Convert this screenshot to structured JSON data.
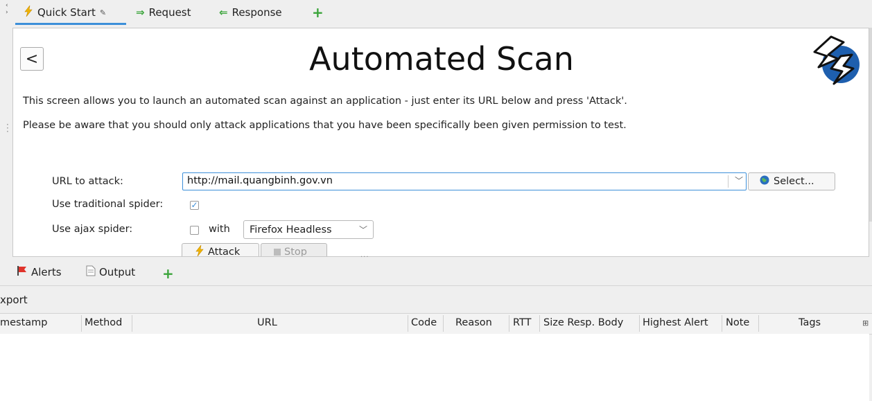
{
  "top_tabs": [
    {
      "label": "Quick Start",
      "icon": "lightning-icon",
      "pinned": true
    },
    {
      "label": "Request",
      "icon": "arrow-right-icon"
    },
    {
      "label": "Response",
      "icon": "arrow-left-icon"
    }
  ],
  "quick_start": {
    "back_label": "<",
    "title": "Automated Scan",
    "description_1": "This screen allows you to launch an automated scan against  an application - just enter its URL below and press 'Attack'.",
    "description_2": "Please be aware that you should only attack applications that you have been specifically been given permission to test.",
    "url_label": "URL to attack:",
    "url_value": "http://mail.quangbinh.gov.vn",
    "select_label": "Select...",
    "traditional_spider_label": "Use traditional spider:",
    "traditional_spider_checked": true,
    "ajax_spider_label": "Use ajax spider:",
    "ajax_spider_checked": false,
    "with_label": "with",
    "browser_value": "Firefox Headless",
    "attack_label": "Attack",
    "stop_label": "Stop"
  },
  "bottom_tabs": [
    {
      "label": "Alerts",
      "icon": "flag-icon"
    },
    {
      "label": "Output",
      "icon": "document-icon"
    }
  ],
  "export_label": "xport",
  "table": {
    "columns": [
      "mestamp",
      "Method",
      "URL",
      "Code",
      "Reason",
      "RTT",
      "Size Resp. Body",
      "Highest Alert",
      "Note",
      "Tags"
    ]
  },
  "colors": {
    "accent": "#3c8fd9",
    "add_green": "#3aa43a",
    "flag_red": "#e0332b",
    "lightning_yellow": "#f0b400",
    "logo_blue": "#1e5fae"
  }
}
